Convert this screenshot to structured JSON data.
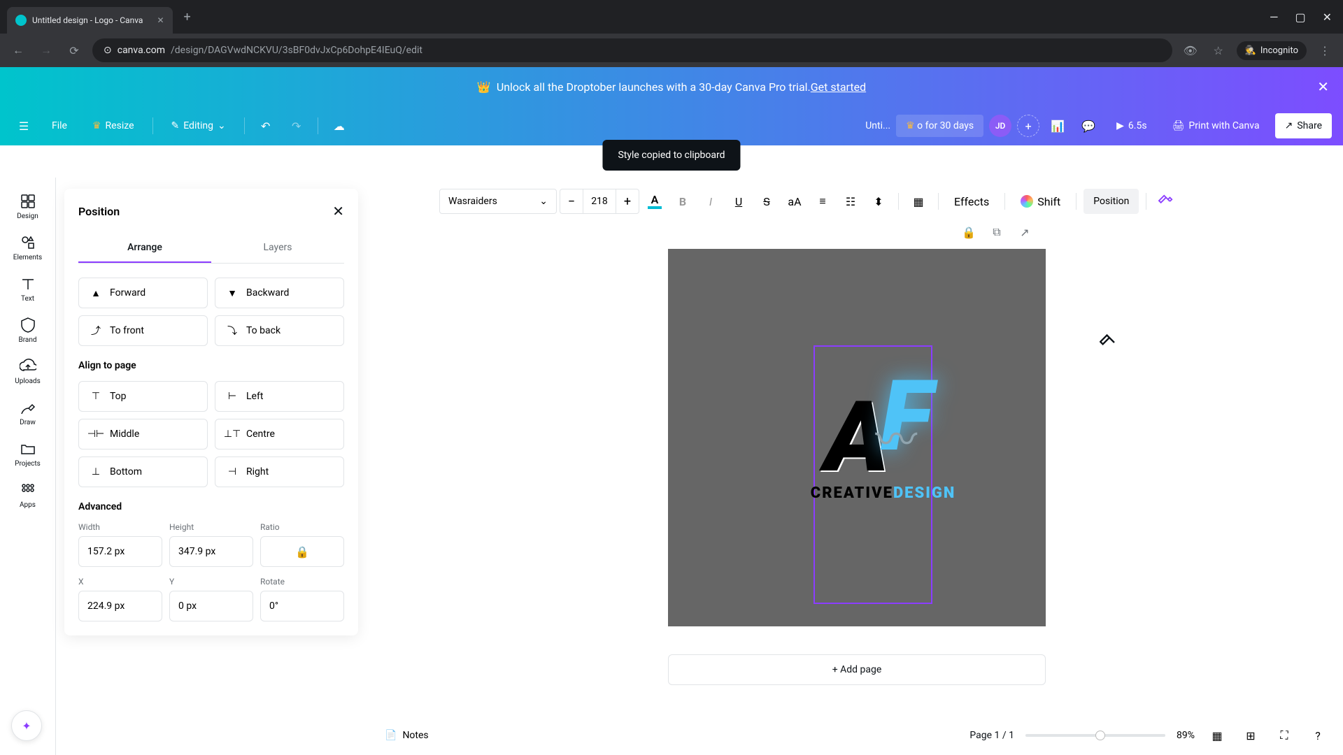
{
  "browser": {
    "tab_title": "Untitled design - Logo - Canva",
    "url_host": "canva.com",
    "url_path": "/design/DAGVwdNCKVU/3sBF0dvJxCp6DohpE4IEuQ/edit",
    "incognito": "Incognito"
  },
  "promo": {
    "text_pre": "Unlock all the Droptober launches with a 30-day Canva Pro trial. ",
    "cta": "Get started"
  },
  "toolbar": {
    "file": "File",
    "resize": "Resize",
    "editing": "Editing",
    "doc_title": "Unti...",
    "trial": "o for 30 days",
    "avatar_initials": "JD",
    "duration": "6.5s",
    "print": "Print with Canva",
    "share": "Share"
  },
  "toast": "Style copied to clipboard",
  "text_toolbar": {
    "font": "Wasraiders",
    "size": "218",
    "effects": "Effects",
    "shift": "Shift",
    "position": "Position"
  },
  "sidebar": {
    "items": [
      {
        "label": "Design"
      },
      {
        "label": "Elements"
      },
      {
        "label": "Text"
      },
      {
        "label": "Brand"
      },
      {
        "label": "Uploads"
      },
      {
        "label": "Draw"
      },
      {
        "label": "Projects"
      },
      {
        "label": "Apps"
      }
    ]
  },
  "panel": {
    "title": "Position",
    "tabs": {
      "arrange": "Arrange",
      "layers": "Layers"
    },
    "layer_btns": {
      "forward": "Forward",
      "backward": "Backward",
      "to_front": "To front",
      "to_back": "To back"
    },
    "align_title": "Align to page",
    "align_btns": {
      "top": "Top",
      "left": "Left",
      "middle": "Middle",
      "centre": "Centre",
      "bottom": "Bottom",
      "right": "Right"
    },
    "advanced_title": "Advanced",
    "fields": {
      "width_label": "Width",
      "width_val": "157.2 px",
      "height_label": "Height",
      "height_val": "347.9 px",
      "ratio_label": "Ratio",
      "x_label": "X",
      "x_val": "224.9 px",
      "y_label": "Y",
      "y_val": "0 px",
      "rotate_label": "Rotate",
      "rotate_val": "0°"
    }
  },
  "canvas": {
    "logo_creative": "CREATIVE",
    "logo_design": "DESIGN",
    "add_page": "+ Add page"
  },
  "bottom": {
    "notes": "Notes",
    "page_info": "Page 1 / 1",
    "zoom": "89%"
  }
}
